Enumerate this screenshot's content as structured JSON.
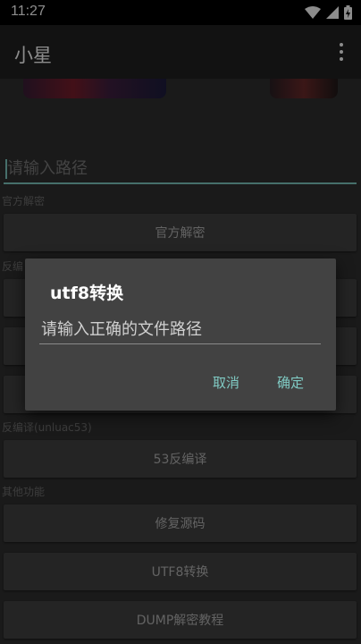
{
  "status_bar": {
    "time": "11:27"
  },
  "app_bar": {
    "title": "小星"
  },
  "main": {
    "path_placeholder": "请输入路径",
    "sections": [
      {
        "label": "官方解密"
      },
      {
        "label": "反编"
      },
      {
        "label": "反编译(unluac53)"
      },
      {
        "label": "其他功能"
      }
    ],
    "buttons": [
      {
        "label": "官方解密"
      },
      {
        "label": ""
      },
      {
        "label": ""
      },
      {
        "label": ""
      },
      {
        "label": "53反编译"
      },
      {
        "label": "修复源码"
      },
      {
        "label": "UTF8转换"
      },
      {
        "label": "DUMP解密教程"
      }
    ]
  },
  "dialog": {
    "title": "utf8转换",
    "input_placeholder": "请输入正确的文件路径",
    "cancel_label": "取消",
    "confirm_label": "确定"
  },
  "colors": {
    "accent": "#80cbc4",
    "app_bar": "#212121",
    "background": "#303030",
    "button": "#424242"
  }
}
